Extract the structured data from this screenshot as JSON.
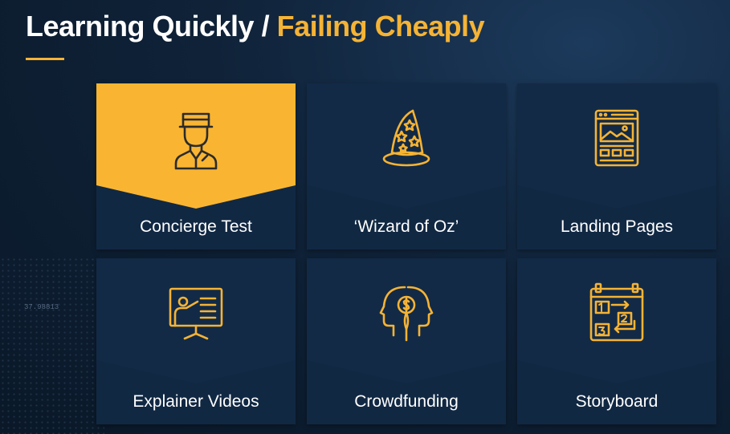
{
  "header": {
    "title_main": "Learning Quickly / ",
    "title_accent": "Failing Cheaply"
  },
  "background": {
    "number_text": "37.98813"
  },
  "colors": {
    "accent": "#f5b335",
    "tile_bg": "#112843",
    "active_tile_bg": "#f9b532",
    "page_bg": "#0f2238"
  },
  "tiles": [
    {
      "label": "Concierge Test",
      "icon": "concierge-icon",
      "active": true
    },
    {
      "label": "‘Wizard of Oz’",
      "icon": "wizard-hat-icon",
      "active": false
    },
    {
      "label": "Landing Pages",
      "icon": "landing-page-icon",
      "active": false
    },
    {
      "label": "Explainer Videos",
      "icon": "presentation-icon",
      "active": false
    },
    {
      "label": "Crowdfunding",
      "icon": "crowdfunding-heads-icon",
      "active": false
    },
    {
      "label": "Storyboard",
      "icon": "storyboard-icon",
      "active": false
    }
  ]
}
